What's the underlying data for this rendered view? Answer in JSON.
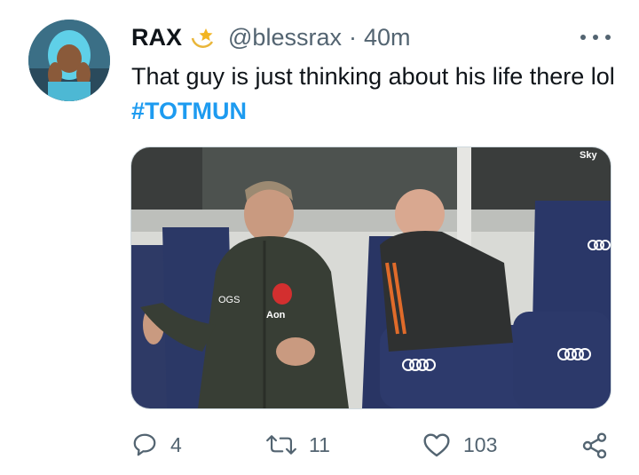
{
  "tweet": {
    "display_name": "RAX",
    "handle": "@blessrax",
    "separator": "·",
    "time": "40m",
    "text": "That guy is just thinking about his life there lol ",
    "hashtag": "#TOTMUN",
    "more_icon": "more-horizontal-icon",
    "badge_icon": "star-badge-icon"
  },
  "media": {
    "sponsor_logo_text": "Aon",
    "badge_text": "OGS",
    "watermark": "Sky"
  },
  "actions": {
    "reply_count": "4",
    "retweet_count": "11",
    "like_count": "103"
  },
  "colors": {
    "accent": "#1d9bf0",
    "muted": "#536471",
    "text": "#0f1419"
  }
}
